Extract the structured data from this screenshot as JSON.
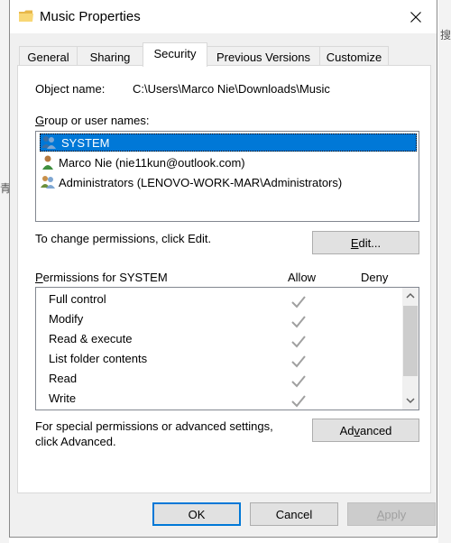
{
  "window": {
    "title": "Music Properties",
    "close_label": "Close"
  },
  "tabs": [
    "General",
    "Sharing",
    "Security",
    "Previous Versions",
    "Customize"
  ],
  "active_tab": "Security",
  "object": {
    "label": "Object name:",
    "value": "C:\\Users\\Marco Nie\\Downloads\\Music"
  },
  "groups": {
    "label": "Group or user names:",
    "items": [
      {
        "name": "SYSTEM",
        "icon": "users-group-icon",
        "selected": true
      },
      {
        "name": "Marco Nie (nie11kun@outlook.com)",
        "icon": "user-icon",
        "selected": false
      },
      {
        "name": "Administrators (LENOVO-WORK-MAR\\Administrators)",
        "icon": "users-group-icon",
        "selected": false
      }
    ]
  },
  "change_hint": "To change permissions, click Edit.",
  "edit_button": "Edit...",
  "permissions": {
    "title": "Permissions for SYSTEM",
    "allow_label": "Allow",
    "deny_label": "Deny",
    "rows": [
      {
        "name": "Full control",
        "allow": true,
        "deny": false
      },
      {
        "name": "Modify",
        "allow": true,
        "deny": false
      },
      {
        "name": "Read & execute",
        "allow": true,
        "deny": false
      },
      {
        "name": "List folder contents",
        "allow": true,
        "deny": false
      },
      {
        "name": "Read",
        "allow": true,
        "deny": false
      },
      {
        "name": "Write",
        "allow": true,
        "deny": false
      }
    ]
  },
  "special": {
    "line1": "For special permissions or advanced settings,",
    "line2": "click Advanced."
  },
  "advanced_button": "Advanced",
  "footer": {
    "ok": "OK",
    "cancel": "Cancel",
    "apply": "Apply"
  },
  "colors": {
    "accent": "#0078d7",
    "check_gray": "#a0a0a0",
    "window_bg": "#f0f0f0"
  }
}
